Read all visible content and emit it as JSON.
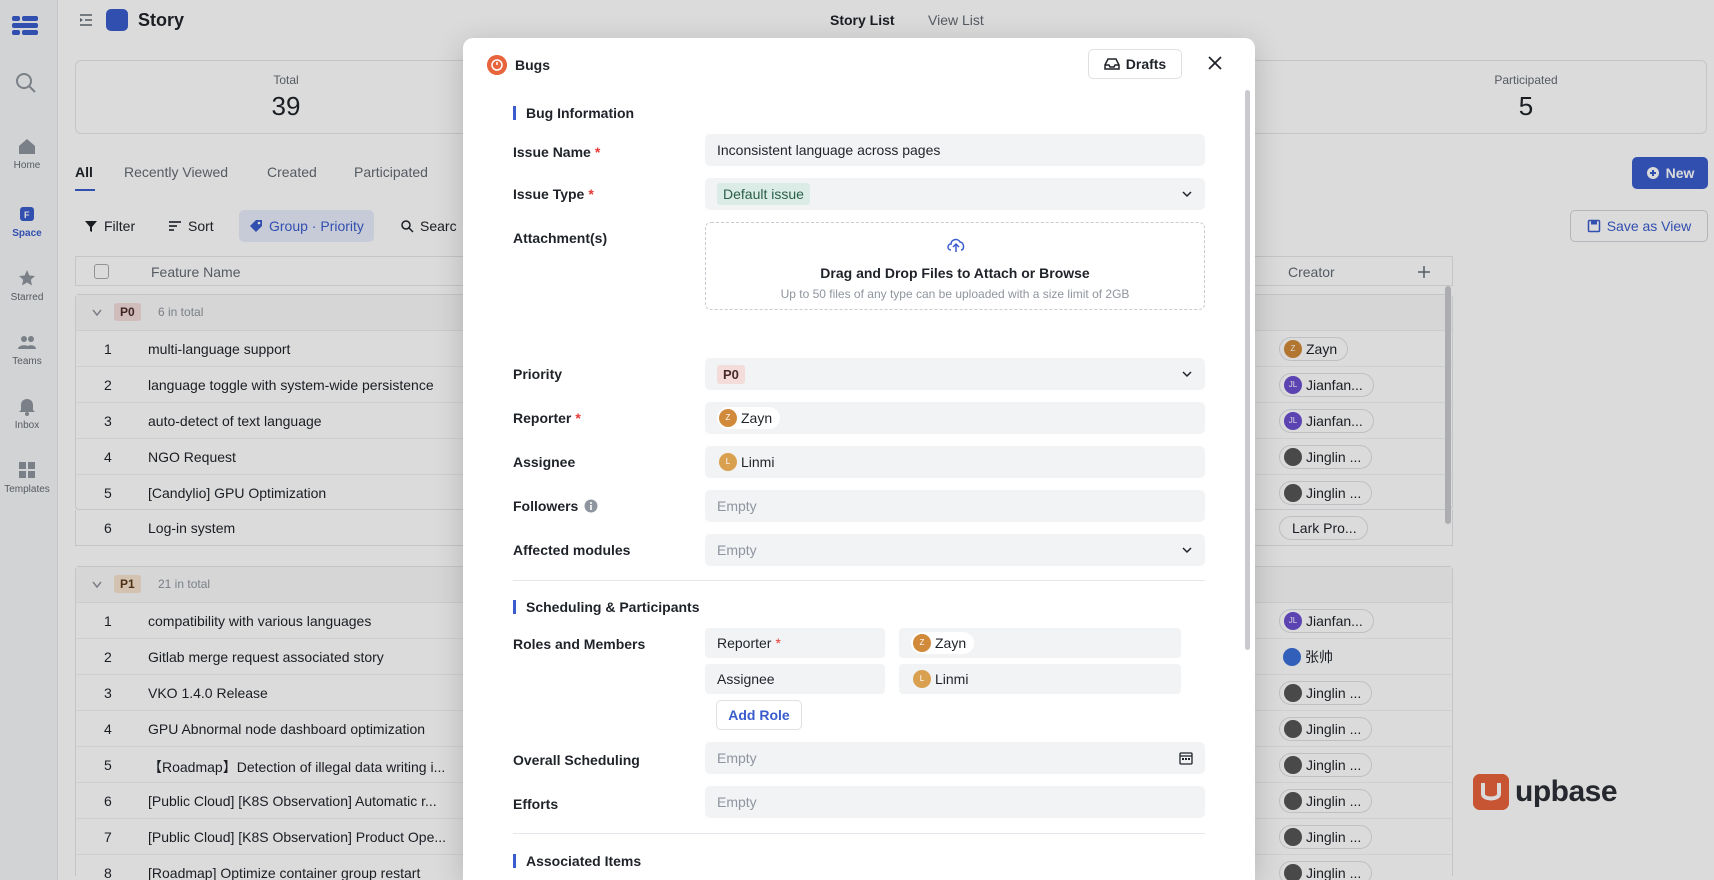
{
  "app": {
    "title": "Story",
    "segments": [
      "Story List",
      "View List"
    ]
  },
  "rail": [
    {
      "label": "Home",
      "icon": "home-icon"
    },
    {
      "label": "Space",
      "icon": "space-icon"
    },
    {
      "label": "Starred",
      "icon": "star-icon"
    },
    {
      "label": "Teams",
      "icon": "teams-icon"
    },
    {
      "label": "Inbox",
      "icon": "bell-icon"
    },
    {
      "label": "Templates",
      "icon": "templates-icon"
    }
  ],
  "stats": {
    "total_label": "Total",
    "total_value": "39",
    "participated_label": "Participated",
    "participated_value": "5"
  },
  "tabs": [
    "All",
    "Recently Viewed",
    "Created",
    "Participated"
  ],
  "toolbar": {
    "filter": "Filter",
    "sort": "Sort",
    "group": "Group · Priority",
    "search": "Searc",
    "new": "New",
    "save_view": "Save as View"
  },
  "table": {
    "col_feature": "Feature Name",
    "col_creator": "Creator",
    "groups": [
      {
        "badge": "P0",
        "count": "6 in total",
        "rows": [
          {
            "n": "1",
            "name": "multi-language support",
            "creator": "Zayn"
          },
          {
            "n": "2",
            "name": "language toggle with system-wide persistence",
            "creator": "Jianfan..."
          },
          {
            "n": "3",
            "name": "auto-detect of text language",
            "creator": "Jianfan..."
          },
          {
            "n": "4",
            "name": "NGO Request",
            "creator": "Jinglin ..."
          },
          {
            "n": "5",
            "name": "[Candylio] GPU Optimization",
            "creator": "Jinglin ..."
          },
          {
            "n": "6",
            "name": "Log-in system",
            "creator": "Lark Pro..."
          }
        ]
      },
      {
        "badge": "P1",
        "count": "21 in total",
        "rows": [
          {
            "n": "1",
            "name": "compatibility with various languages",
            "creator": "Jianfan..."
          },
          {
            "n": "2",
            "name": "Gitlab merge request associated story",
            "creator": "张帅"
          },
          {
            "n": "3",
            "name": "VKO 1.4.0 Release",
            "creator": "Jinglin ..."
          },
          {
            "n": "4",
            "name": "GPU Abnormal node dashboard optimization",
            "creator": "Jinglin ..."
          },
          {
            "n": "5",
            "name": "【Roadmap】Detection of illegal data writing i...",
            "creator": "Jinglin ..."
          },
          {
            "n": "6",
            "name": "[Public Cloud] [K8S Observation] Automatic r...",
            "creator": "Jinglin ..."
          },
          {
            "n": "7",
            "name": "[Public Cloud] [K8S Observation] Product Ope...",
            "creator": "Jinglin ..."
          },
          {
            "n": "8",
            "name": "[Roadmap] Optimize container group restart",
            "creator": "Jinglin ..."
          }
        ]
      }
    ]
  },
  "modal": {
    "title": "Bugs",
    "drafts": "Drafts",
    "sec_info": "Bug Information",
    "issue_name_label": "Issue Name",
    "issue_name_value": "Inconsistent language across pages",
    "issue_type_label": "Issue Type",
    "issue_type_value": "Default issue",
    "attachments_label": "Attachment(s)",
    "drop_title": "Drag and Drop Files to Attach or Browse",
    "drop_sub": "Up to 50 files of any type can be uploaded with a size limit of 2GB",
    "priority_label": "Priority",
    "priority_value": "P0",
    "reporter_label": "Reporter",
    "reporter_value": "Zayn",
    "assignee_label": "Assignee",
    "assignee_value": "Linmi",
    "followers_label": "Followers",
    "followers_value": "Empty",
    "affected_label": "Affected modules",
    "affected_value": "Empty",
    "sec_sched": "Scheduling & Participants",
    "roles_label": "Roles and Members",
    "role1": "Reporter",
    "role1_member": "Zayn",
    "role2": "Assignee",
    "role2_member": "Linmi",
    "add_role": "Add Role",
    "overall_label": "Overall Scheduling",
    "overall_value": "Empty",
    "efforts_label": "Efforts",
    "efforts_value": "Empty",
    "sec_assoc": "Associated Items",
    "required_mark": "*"
  },
  "brand": "upbase"
}
